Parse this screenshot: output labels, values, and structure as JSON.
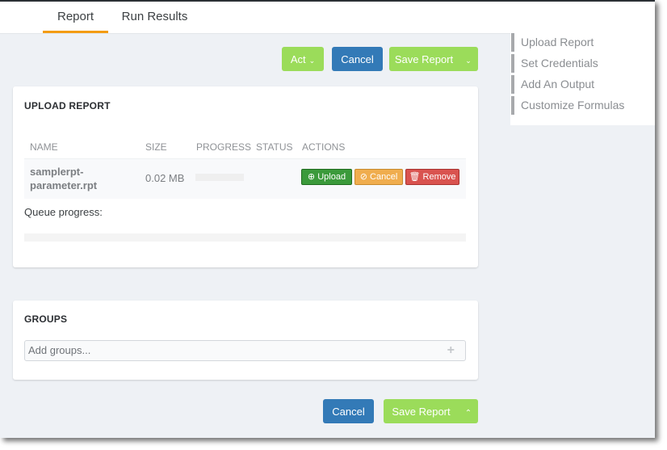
{
  "tabs": [
    {
      "label": "Report",
      "active": true
    },
    {
      "label": "Run Results",
      "active": false
    }
  ],
  "toolbar": {
    "act_label": "Act",
    "cancel_label": "Cancel",
    "save_label": "Save Report"
  },
  "sidenav": {
    "items": [
      {
        "label": "Upload Report"
      },
      {
        "label": "Set Credentials"
      },
      {
        "label": "Add An Output"
      },
      {
        "label": "Customize Formulas"
      }
    ]
  },
  "upload": {
    "title": "UPLOAD REPORT",
    "columns": [
      "NAME",
      "SIZE",
      "PROGRESS",
      "STATUS",
      "ACTIONS"
    ],
    "rows": [
      {
        "name_line1": "samplerpt-",
        "name_line2": "parameter.rpt",
        "size": "0.02 MB",
        "progress": 0,
        "status": "",
        "actions": {
          "upload": "Upload",
          "cancel": "Cancel",
          "remove": "Remove"
        }
      }
    ],
    "queue_label": "Queue progress:",
    "queue_progress": 0
  },
  "groups": {
    "title": "GROUPS",
    "placeholder": "Add groups..."
  },
  "footer": {
    "cancel_label": "Cancel",
    "save_label": "Save Report"
  },
  "colors": {
    "accent_tab": "#f39c12",
    "green": "#9bdc5a",
    "blue": "#337ab7",
    "upload": "#3b9a3b",
    "cancel": "#f0ad4e",
    "remove": "#d9534f"
  }
}
